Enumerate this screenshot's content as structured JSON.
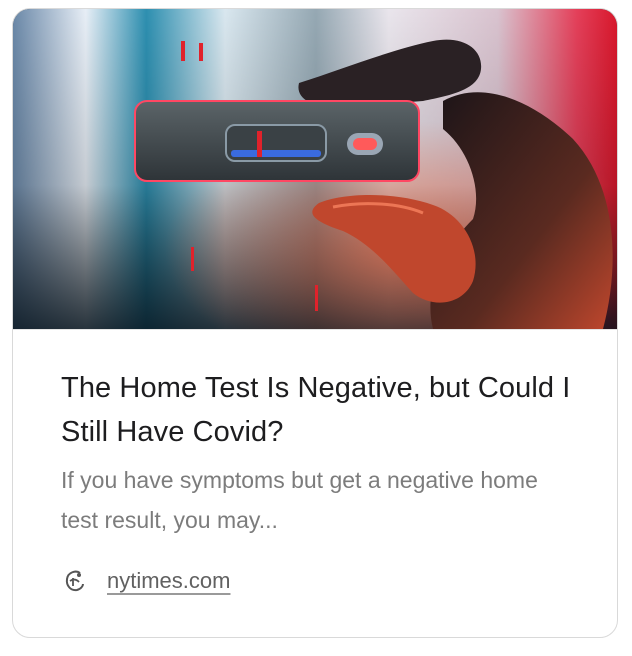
{
  "article": {
    "headline": "The Home Test Is Negative, but Could I Still Have Covid?",
    "summary": "If you have symptoms but get a negative home test result, you may...",
    "source": "nytimes.com"
  },
  "icons": {
    "favicon": "nytimes-favicon-icon"
  },
  "colors": {
    "card_border": "#d9d9d9",
    "headline": "#1d1d1f",
    "summary": "#7c7c7c",
    "source": "#616161",
    "accent_red": "#e0222b"
  }
}
